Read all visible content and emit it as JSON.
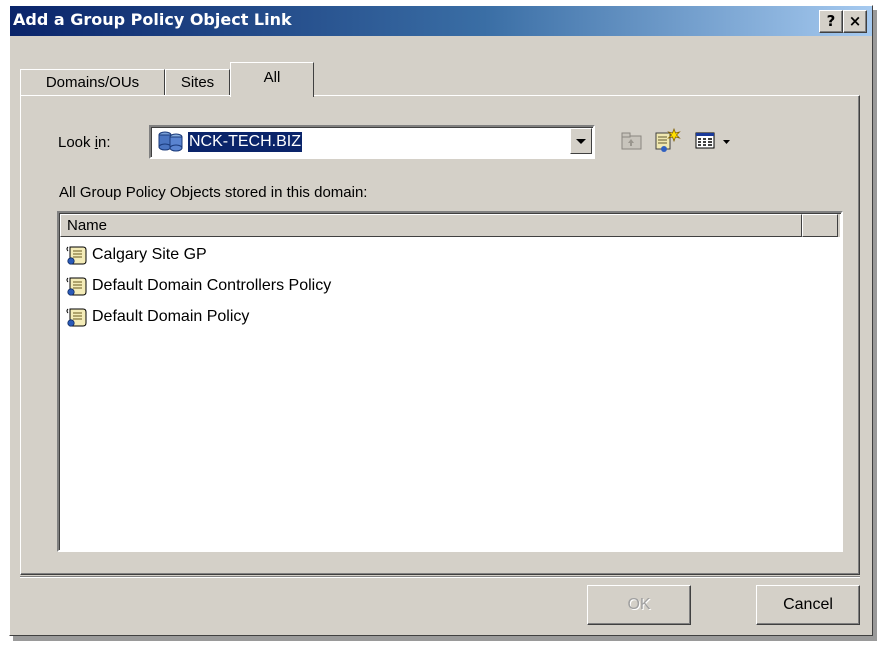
{
  "window": {
    "title": "Add a Group Policy Object Link",
    "help_label": "?",
    "close_label": "×"
  },
  "tabs": [
    {
      "label": "Domains/OUs",
      "active": false
    },
    {
      "label": "Sites",
      "active": false
    },
    {
      "label": "All",
      "active": true
    }
  ],
  "lookin": {
    "label_prefix": "Look ",
    "label_accel": "i",
    "label_suffix": "n:",
    "value": "NCK-TECH.BIZ"
  },
  "toolbar_icons": [
    "up-folder-icon",
    "new-gpo-icon",
    "view-menu-icon",
    "chevron-down-icon"
  ],
  "caption": "All Group Policy Objects stored in this domain:",
  "list": {
    "columns": [
      "Name"
    ],
    "rows": [
      {
        "name": "Calgary Site GP",
        "icon": "gpo-scroll-icon"
      },
      {
        "name": "Default Domain Controllers Policy",
        "icon": "gpo-scroll-icon"
      },
      {
        "name": "Default Domain Policy",
        "icon": "gpo-scroll-icon"
      }
    ]
  },
  "buttons": {
    "ok_label": "OK",
    "ok_enabled": false,
    "cancel_label": "Cancel"
  }
}
